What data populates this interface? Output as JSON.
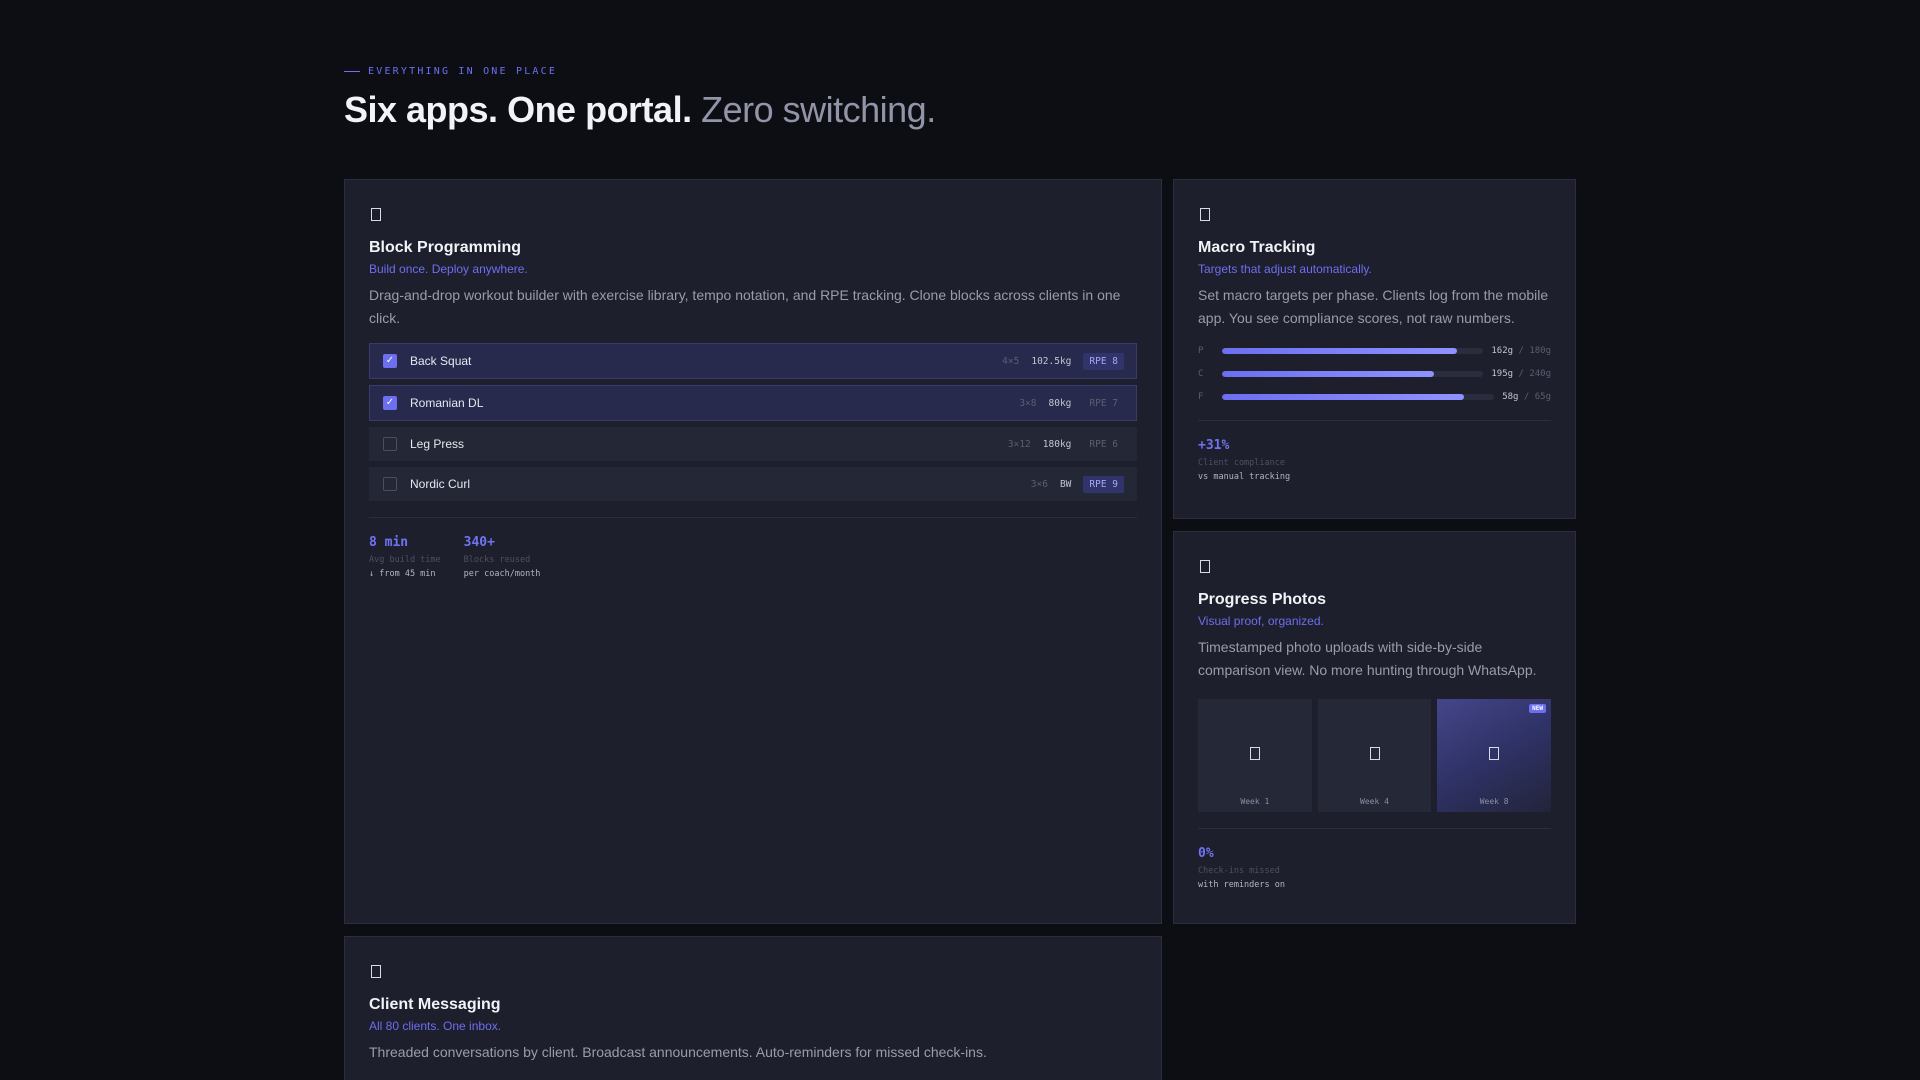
{
  "header": {
    "eyebrow": "EVERYTHING IN ONE PLACE",
    "title_strong": "Six apps. One portal.",
    "title_muted": "Zero switching."
  },
  "block_programming": {
    "icon": "document-icon",
    "title": "Block Programming",
    "tagline": "Build once. Deploy anywhere.",
    "description": "Drag-and-drop workout builder with exercise library, tempo notation, and RPE tracking. Clone blocks across clients in one click.",
    "exercises": [
      {
        "name": "Back Squat",
        "sets": "4×5",
        "load": "102.5kg",
        "rpe": "RPE 8",
        "checked": true,
        "rpe_highlight": true
      },
      {
        "name": "Romanian DL",
        "sets": "3×8",
        "load": "80kg",
        "rpe": "RPE 7",
        "checked": true,
        "rpe_highlight": false
      },
      {
        "name": "Leg Press",
        "sets": "3×12",
        "load": "180kg",
        "rpe": "RPE 6",
        "checked": false,
        "rpe_highlight": false
      },
      {
        "name": "Nordic Curl",
        "sets": "3×6",
        "load": "BW",
        "rpe": "RPE 9",
        "checked": false,
        "rpe_highlight": true
      }
    ],
    "stats": [
      {
        "value": "8 min",
        "label": "Avg build time",
        "sub": "↓ from 45 min"
      },
      {
        "value": "340+",
        "label": "Blocks reused",
        "sub": "per coach/month"
      }
    ]
  },
  "macro_tracking": {
    "icon": "document-icon",
    "title": "Macro Tracking",
    "tagline": "Targets that adjust automatically.",
    "description": "Set macro targets per phase. Clients log from the mobile app. You see compliance scores, not raw numbers.",
    "macros": [
      {
        "key": "P",
        "current": "162g",
        "target": "/ 180g",
        "progress": 0.9
      },
      {
        "key": "C",
        "current": "195g",
        "target": "/ 240g",
        "progress": 0.81
      },
      {
        "key": "F",
        "current": "58g",
        "target": "/ 65g",
        "progress": 0.89
      }
    ],
    "stat": {
      "value": "+31%",
      "label": "Client compliance",
      "sub": "vs manual tracking"
    }
  },
  "progress_photos": {
    "icon": "document-icon",
    "title": "Progress Photos",
    "tagline": "Visual proof, organized.",
    "description": "Timestamped photo uploads with side-by-side comparison view. No more hunting through WhatsApp.",
    "photos": [
      {
        "week": "Week 1",
        "badge": ""
      },
      {
        "week": "Week 4",
        "badge": ""
      },
      {
        "week": "Week 8",
        "badge": "NEW"
      }
    ],
    "stat": {
      "value": "0%",
      "label": "Check-ins missed",
      "sub": "with reminders on"
    }
  },
  "client_messaging": {
    "icon": "document-icon",
    "title": "Client Messaging",
    "tagline": "All 80 clients. One inbox.",
    "description": "Threaded conversations by client. Broadcast announcements. Auto-reminders for missed check-ins."
  }
}
